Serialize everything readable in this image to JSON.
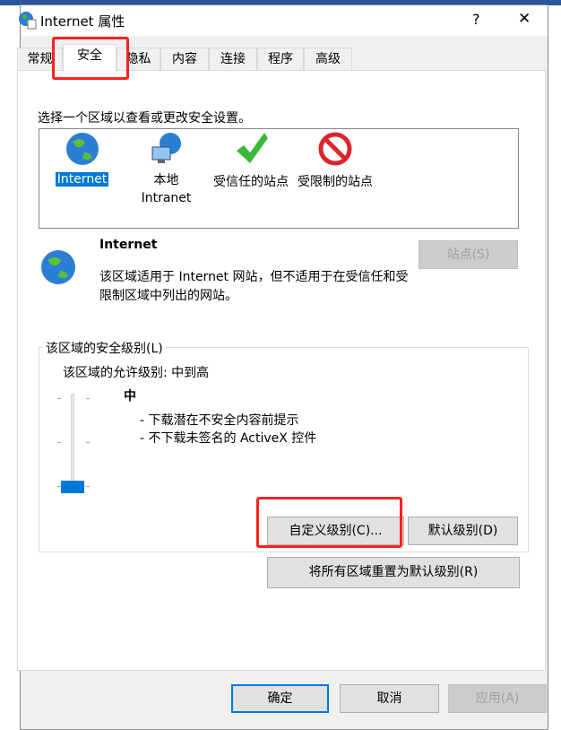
{
  "window": {
    "title": "Internet 属性",
    "help": "?",
    "close": "✕"
  },
  "tabs": [
    "常规",
    "安全",
    "隐私",
    "内容",
    "连接",
    "程序",
    "高级"
  ],
  "selected_tab": "安全",
  "security": {
    "instruction": "选择一个区域以查看或更改安全设置。",
    "zones": [
      {
        "label": "Internet",
        "icon": "globe-icon",
        "selected": true
      },
      {
        "label": "本地\nIntranet",
        "icon": "intranet-icon"
      },
      {
        "label": "受信任的站点",
        "icon": "checkmark-icon"
      },
      {
        "label": "受限制的站点",
        "icon": "restricted-icon"
      }
    ],
    "zone_title": "Internet",
    "zone_desc": "该区域适用于 Internet 网站，但不适用于在受信任和受限制区域中列出的网站。",
    "sites_button": "站点(S)",
    "group_label": "该区域的安全级别(L)",
    "allowed_levels": "该区域的允许级别: 中到高",
    "level_name": "中",
    "level_items": [
      "- 下载潜在不安全内容前提示",
      "- 不下载未签名的 ActiveX 控件"
    ],
    "slider_level": "中",
    "custom_button": "自定义级别(C)...",
    "default_button": "默认级别(D)",
    "reset_all_button": "将所有区域重置为默认级别(R)"
  },
  "footer": {
    "ok": "确定",
    "cancel": "取消",
    "apply": "应用(A)"
  },
  "colors": {
    "accent": "#0078d7",
    "highlight_box": "#ff2020"
  }
}
